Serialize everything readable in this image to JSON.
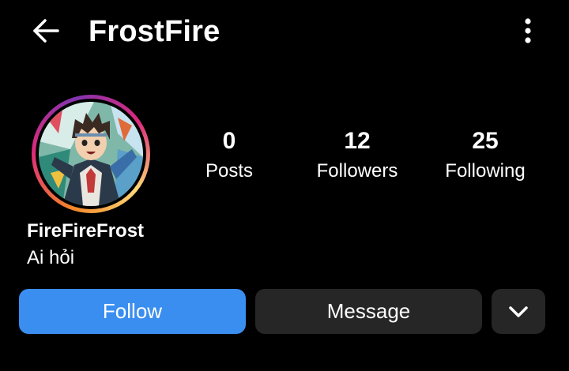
{
  "header": {
    "title": "FrostFire",
    "back_icon": "arrow-left-icon",
    "more_icon": "more-vertical-icon"
  },
  "profile": {
    "username": "FireFireFrost",
    "bio": "Ai hỏi",
    "avatar": "avatar-image"
  },
  "stats": [
    {
      "value": "0",
      "label": "Posts"
    },
    {
      "value": "12",
      "label": "Followers"
    },
    {
      "value": "25",
      "label": "Following"
    }
  ],
  "actions": {
    "follow_label": "Follow",
    "message_label": "Message",
    "dropdown_icon": "chevron-down-icon"
  },
  "colors": {
    "background": "#000000",
    "follow_button": "#3a8ef0",
    "secondary_button": "#262626",
    "text": "#ffffff"
  }
}
